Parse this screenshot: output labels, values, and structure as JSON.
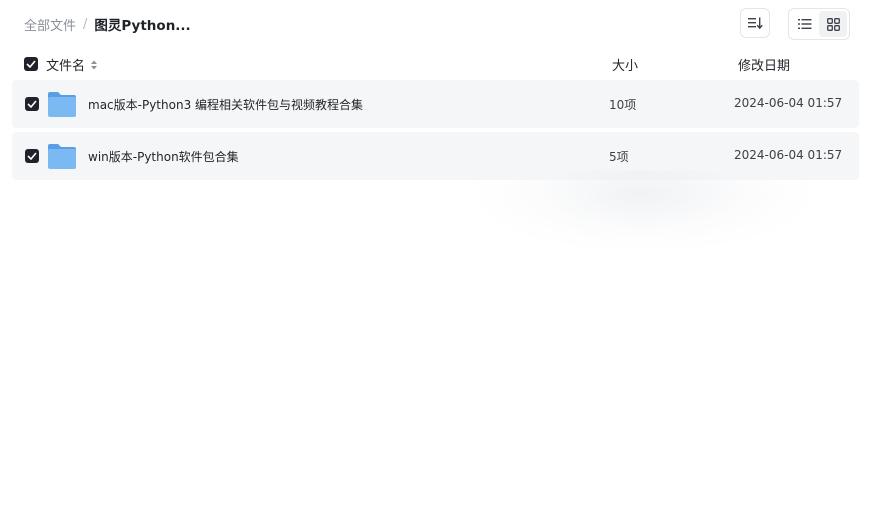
{
  "breadcrumb": {
    "root": "全部文件",
    "separator": "/",
    "current": "图灵Python..."
  },
  "toolbar": {
    "sort_icon": "sort-icon",
    "view_list_icon": "list-view-icon",
    "view_grid_icon": "grid-view-icon"
  },
  "columns": {
    "name": "文件名",
    "size": "大小",
    "date": "修改日期"
  },
  "files": [
    {
      "name": "mac版本-Python3 编程相关软件包与视频教程合集",
      "count": "10项",
      "date": "2024-06-04 01:57",
      "selected": true
    },
    {
      "name": "win版本-Python软件包合集",
      "count": "5项",
      "date": "2024-06-04 01:57",
      "selected": true
    }
  ],
  "colors": {
    "folder": "#6aaef0",
    "row_bg": "#f5f6f7",
    "checkbox": "#1f2329"
  }
}
